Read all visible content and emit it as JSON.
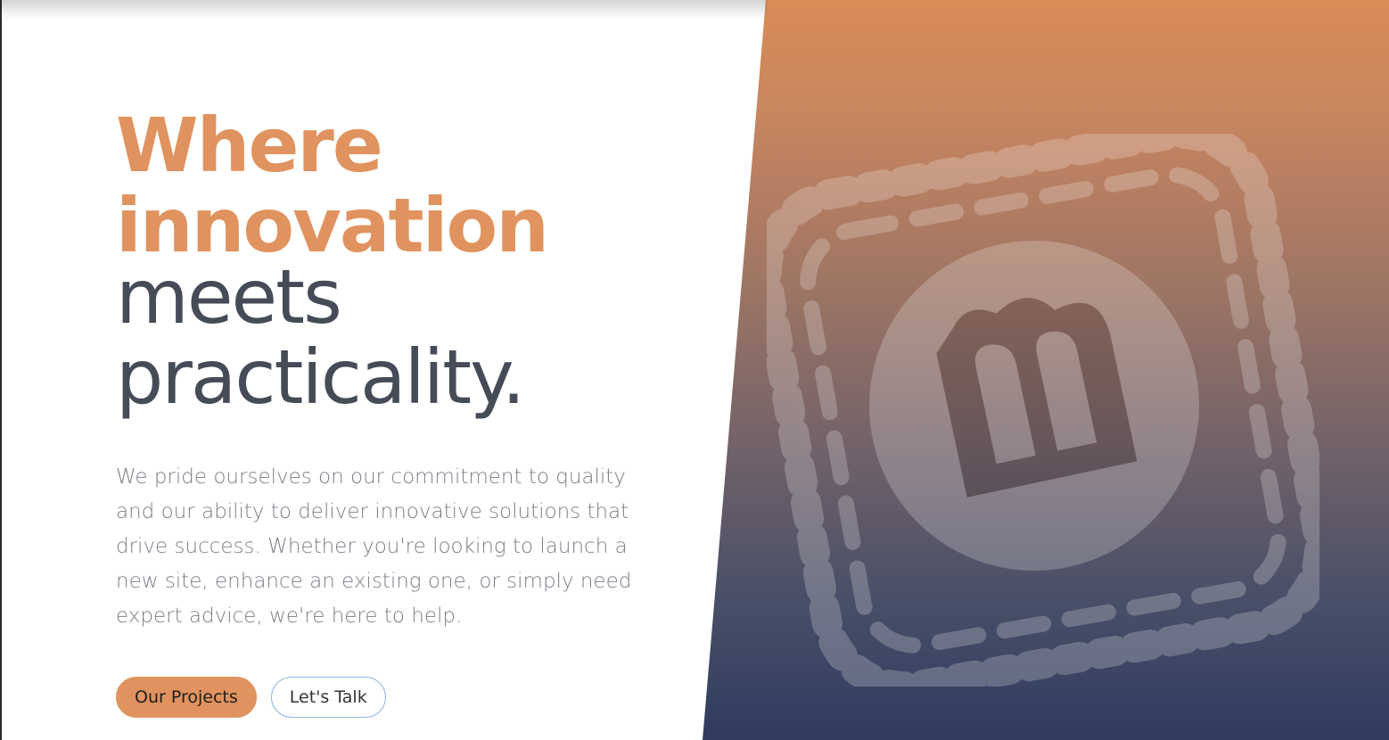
{
  "hero": {
    "headline": {
      "line1": "Where",
      "line2": "innovation",
      "line3": "meets",
      "line4": "practicality."
    },
    "description": "We pride ourselves on our commitment to quality and our ability to deliver innovative solutions that drive success. Whether you're looking to launch a new site, enhance an existing one, or simply need expert advice, we're here to help.",
    "buttons": {
      "primary_label": "Our Projects",
      "secondary_label": "Let's Talk"
    }
  },
  "emblem": {
    "icon": "brand-emblem-icon"
  },
  "colors": {
    "accent": "#e0935f",
    "heading_dark": "#454b57",
    "body_text": "#7a7f89",
    "gradient_top": "#d98c56",
    "gradient_bottom": "#2f3b5f",
    "secondary_border": "#8fb6dd"
  }
}
